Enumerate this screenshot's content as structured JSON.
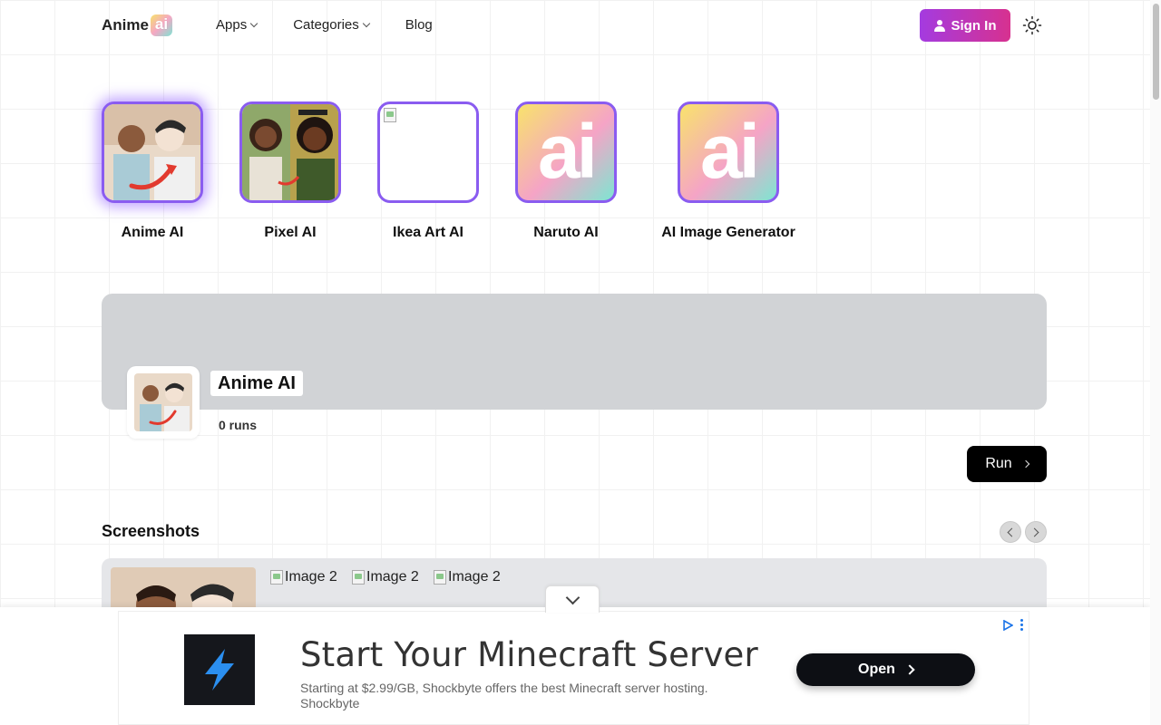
{
  "header": {
    "logo_text": "Anime",
    "logo_badge": "ai",
    "nav": [
      {
        "label": "Apps",
        "has_dropdown": true
      },
      {
        "label": "Categories",
        "has_dropdown": true
      },
      {
        "label": "Blog",
        "has_dropdown": false
      }
    ],
    "sign_in_label": "Sign In",
    "theme_toggle_icon": "sun-icon"
  },
  "apps": [
    {
      "label": "Anime AI",
      "active": true,
      "thumb": "photo"
    },
    {
      "label": "Pixel AI",
      "active": false,
      "thumb": "photo"
    },
    {
      "label": "Ikea Art AI",
      "active": false,
      "thumb": "broken"
    },
    {
      "label": "Naruto AI",
      "active": false,
      "thumb": "ai-logo",
      "thumb_text": "ai"
    },
    {
      "label": "AI Image Generator",
      "active": false,
      "thumb": "ai-logo",
      "thumb_text": "ai"
    }
  ],
  "hero": {
    "title": "Anime AI",
    "runs": "0 runs",
    "run_button": "Run"
  },
  "screenshots": {
    "heading": "Screenshots",
    "broken_images": [
      "Image 2",
      "Image 2",
      "Image 2"
    ]
  },
  "ad": {
    "headline": "Start Your Minecraft Server",
    "description": "Starting at $2.99/GB, Shockbyte offers the best Minecraft server hosting.",
    "advertiser": "Shockbyte",
    "cta": "Open"
  },
  "colors": {
    "accent_gradient_start": "#a43be0",
    "accent_gradient_end": "#d7318f",
    "tile_border": "#8a5cf0",
    "hero_bg": "#d1d3d6"
  }
}
